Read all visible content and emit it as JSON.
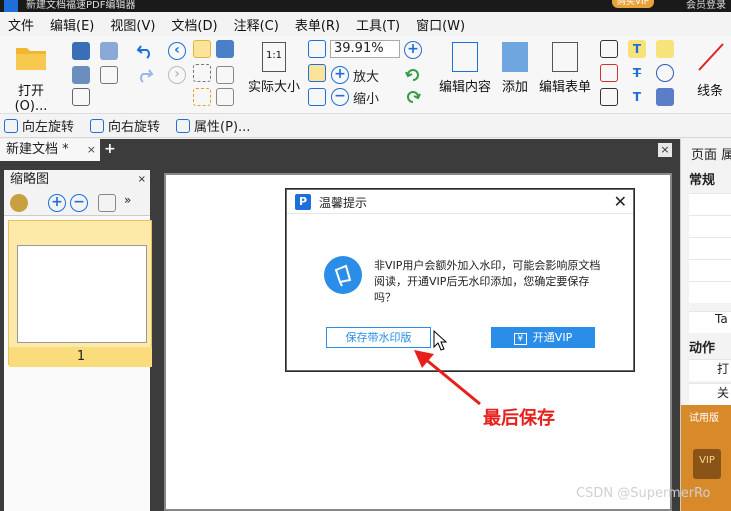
{
  "window": {
    "title": "新建文档福速PDF编辑器",
    "vip_badge": "购买VIP",
    "login": "会员登录"
  },
  "menu": [
    "文件",
    "编辑(E)",
    "视图(V)",
    "文档(D)",
    "注释(C)",
    "表单(R)",
    "工具(T)",
    "窗口(W)"
  ],
  "ribbon": {
    "open_label": "打开(O)...",
    "actual_size_label": "实际大小",
    "actual_size_icon_text": "1:1",
    "zoom_value": "39.91%",
    "zoom_in_label": "放大",
    "zoom_out_label": "缩小",
    "edit_content_label": "编辑内容",
    "add_label": "添加",
    "edit_form_label": "编辑表单",
    "line_label": "线条"
  },
  "subbar": {
    "rotate_left": "向左旋转",
    "rotate_right": "向右旋转",
    "properties": "属性(P)..."
  },
  "tabs": {
    "doc_tab": "新建文档 *",
    "close": "×",
    "add": "+"
  },
  "thumbnails": {
    "title": "缩略图",
    "close": "×",
    "page_number": "1"
  },
  "right_panel": {
    "head": "页面 属",
    "section_general": "常规",
    "row_label": "Ta",
    "section_actions": "动作",
    "action_row1": "打",
    "action_row2": "关",
    "trial": "试用版",
    "vip": "VIP"
  },
  "dialog": {
    "logo_letter": "P",
    "title": "温馨提示",
    "close": "✕",
    "message": "非VIP用户会额外加入水印，可能会影响原文档阅读，开通VIP后无水印添加，您确定要保存吗？",
    "save_watermark_button": "保存带水印版",
    "vip_button": "开通VIP",
    "vip_button_icon": "¥"
  },
  "annotation": {
    "text": "最后保存",
    "color": "#e8201c"
  },
  "watermark": "CSDN @SupermerRo",
  "colors": {
    "accent": "#2a8ee8",
    "dark_bg": "#3c3c3c",
    "selected_thumb": "#fde9a8"
  }
}
